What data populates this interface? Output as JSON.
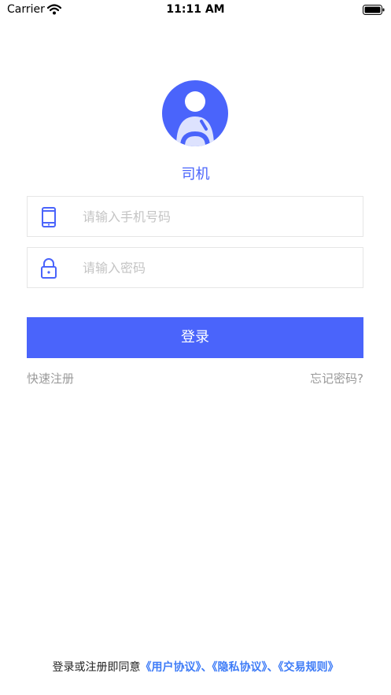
{
  "status_bar": {
    "carrier": "Carrier",
    "time": "11:11 AM"
  },
  "role_label": "司机",
  "phone_field": {
    "placeholder": "请输入手机号码",
    "value": ""
  },
  "password_field": {
    "placeholder": "请输入密码",
    "value": ""
  },
  "login_button": "登录",
  "register_link": "快速注册",
  "forgot_link": "忘记密码?",
  "agreement": {
    "prefix": "登录或注册即同意",
    "links": [
      "《用户协议》",
      "《隐私协议》",
      "《交易规则》"
    ],
    "separator": "、"
  },
  "colors": {
    "accent": "#4a64fb",
    "link": "#3d7bf7",
    "muted_text": "#9a9a9a",
    "border": "#e6e6e6"
  },
  "icons": [
    "wifi-icon",
    "battery-icon",
    "driver-avatar-icon",
    "phone-icon",
    "lock-icon"
  ]
}
